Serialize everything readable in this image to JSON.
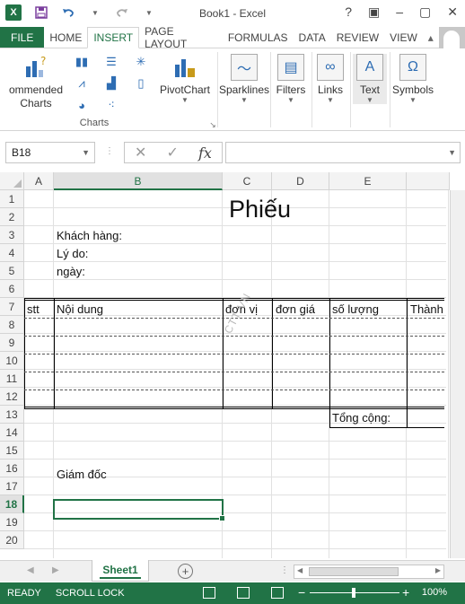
{
  "window": {
    "title": "Book1 - Excel",
    "app_icon_letter": "X",
    "controls": [
      "?",
      "▣",
      "–",
      "▢",
      "✕"
    ]
  },
  "quick_access": {
    "icons": [
      "save-icon",
      "undo-icon",
      "redo-icon",
      "customize-icon"
    ]
  },
  "ribbon_tabs": [
    {
      "label": "FILE",
      "kind": "file"
    },
    {
      "label": "HOME"
    },
    {
      "label": "INSERT",
      "active": true
    },
    {
      "label": "PAGE LAYOUT"
    },
    {
      "label": "FORMULAS"
    },
    {
      "label": "DATA"
    },
    {
      "label": "REVIEW"
    },
    {
      "label": "VIEW"
    }
  ],
  "ribbon": {
    "recommended_charts": "ommended Charts",
    "charts_group": "Charts",
    "pivotchart": "PivotChart",
    "sparklines": "Sparklines",
    "filters": "Filters",
    "links": "Links",
    "text": "Text",
    "symbols": "Symbols"
  },
  "formula_bar": {
    "name_box": "B18",
    "fx": "fx",
    "value": ""
  },
  "columns": [
    "A",
    "B",
    "C",
    "D",
    "E"
  ],
  "rows": [
    "1",
    "2",
    "3",
    "4",
    "5",
    "6",
    "7",
    "8",
    "9",
    "10",
    "11",
    "12",
    "13",
    "14",
    "15",
    "16",
    "17",
    "18",
    "19",
    "20"
  ],
  "selected": {
    "column": "B",
    "row": "18"
  },
  "sheet": {
    "title": "Phiếu",
    "khach_hang": "Khách hàng:",
    "ly_do": "Lý do:",
    "ngay": "ngày:",
    "headers": [
      "stt",
      "Nội dung",
      "đơn vị",
      "đơn giá",
      "số lượng",
      "Thành"
    ],
    "tong_cong": "Tổng cộng:",
    "giam_doc": "Giám đốc",
    "watermark": "CTT VN"
  },
  "sheet_tabs": [
    {
      "label": "Sheet1",
      "active": true
    }
  ],
  "status_bar": {
    "mode": "READY",
    "scroll_lock": "SCROLL LOCK",
    "zoom": "100%"
  },
  "colors": {
    "accent": "#217346",
    "status_bar": "#217346"
  }
}
